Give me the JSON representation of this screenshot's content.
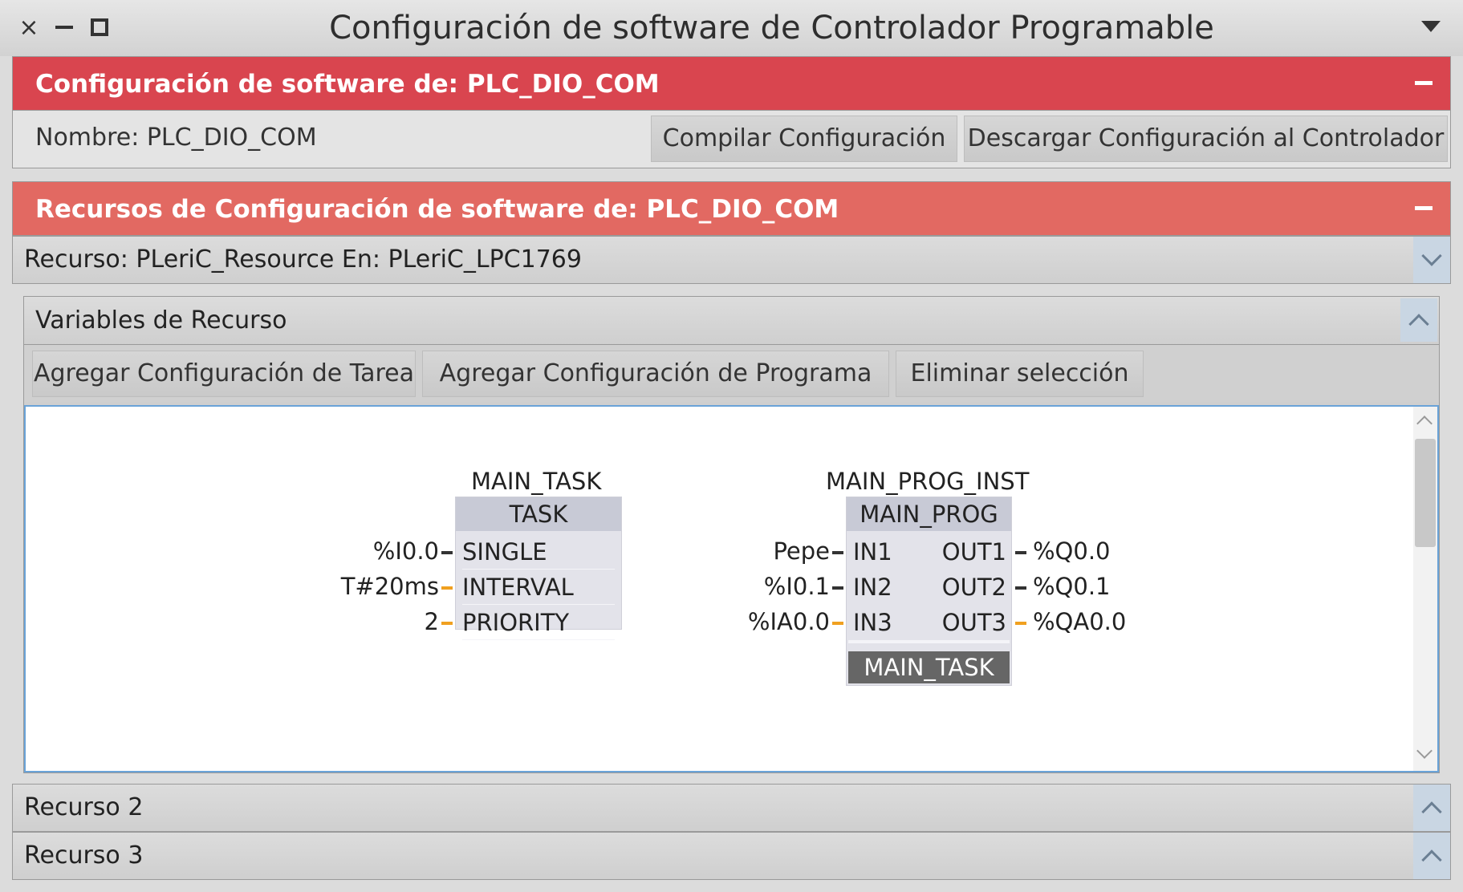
{
  "window": {
    "title": "Configuración de software de Controlador Programable",
    "close_glyph": "×"
  },
  "config_panel": {
    "header": "Configuración de software de: PLC_DIO_COM",
    "name_label": "Nombre: PLC_DIO_COM",
    "compile_button": "Compilar Configuración",
    "download_button": "Descargar Configuración al Controlador"
  },
  "resources_panel": {
    "header": "Recursos de Configuración de software de: PLC_DIO_COM",
    "resource_row": "Recurso: PLeriC_Resource En: PLeriC_LPC1769",
    "variables_header": "Variables de Recurso",
    "toolbar": {
      "add_task": "Agregar Configuración de Tarea",
      "add_program": "Agregar Configuración de Programa",
      "delete_selection": "Eliminar selección"
    },
    "resource2": "Recurso 2",
    "resource3": "Recurso 3"
  },
  "diagram": {
    "task_block": {
      "instance": "MAIN_TASK",
      "type": "TASK",
      "inputs": [
        {
          "port": "SINGLE",
          "value": "%I0.0",
          "wire": "#333333"
        },
        {
          "port": "INTERVAL",
          "value": "T#20ms",
          "wire": "#f0a020"
        },
        {
          "port": "PRIORITY",
          "value": "2",
          "wire": "#f0a020"
        }
      ]
    },
    "program_block": {
      "instance": "MAIN_PROG_INST",
      "type": "MAIN_PROG",
      "inputs": [
        {
          "port": "IN1",
          "value": "Pepe",
          "wire": "#333333"
        },
        {
          "port": "IN2",
          "value": "%I0.1",
          "wire": "#333333"
        },
        {
          "port": "IN3",
          "value": "%IA0.0",
          "wire": "#f0a020"
        }
      ],
      "outputs": [
        {
          "port": "OUT1",
          "value": "%Q0.0",
          "wire": "#333333"
        },
        {
          "port": "OUT2",
          "value": "%Q0.1",
          "wire": "#333333"
        },
        {
          "port": "OUT3",
          "value": "%QA0.0",
          "wire": "#f0a020"
        }
      ],
      "task": "MAIN_TASK"
    }
  },
  "colors": {
    "header_red": "#d9454f",
    "header_red_light": "#e26962",
    "selection_blue": "#6aa3d8"
  }
}
